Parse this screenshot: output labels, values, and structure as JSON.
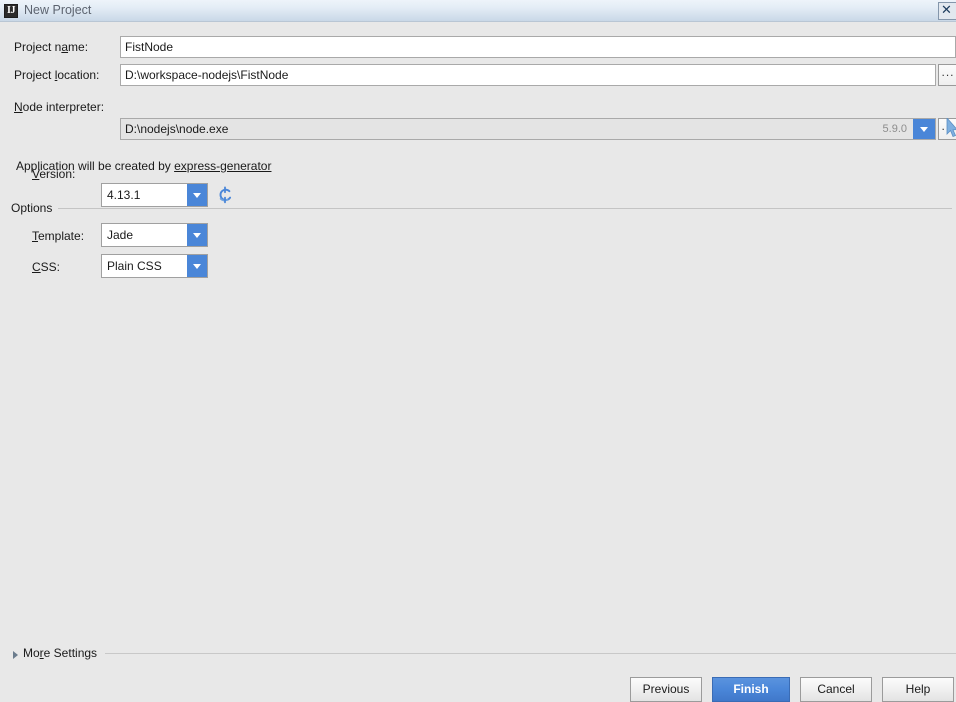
{
  "window": {
    "title": "New Project",
    "app_icon": "intellij-idea-icon",
    "app_icon_text": "IJ",
    "close_label": "✕"
  },
  "form": {
    "project_name": {
      "label_pre": "Project n",
      "label_mnemonic": "a",
      "label_post": "me:",
      "value": "FistNode",
      "placeholder": ""
    },
    "project_location": {
      "label_pre": "Project ",
      "label_mnemonic": "l",
      "label_post": "ocation:",
      "value": "D:\\workspace-nodejs\\FistNode",
      "placeholder": "",
      "browse_label": "..."
    },
    "node_interpreter": {
      "label_pre": "",
      "label_mnemonic": "N",
      "label_post": "ode interpreter:",
      "value": "D:\\nodejs\\node.exe",
      "version_badge": "5.9.0",
      "browse_label": "..."
    },
    "hint": {
      "text_before": "Application will be created by ",
      "link_text": "express-generator"
    },
    "version": {
      "label_pre": "",
      "label_mnemonic": "V",
      "label_post": "ersion:",
      "value": "4.13.1",
      "options": [
        "4.13.1"
      ],
      "refresh_icon": "refresh-icon"
    }
  },
  "options_section": {
    "title": "Options",
    "template": {
      "label_pre": "",
      "label_mnemonic": "T",
      "label_post": "emplate:",
      "value": "Jade",
      "options": [
        "Jade"
      ]
    },
    "css": {
      "label_pre": "",
      "label_mnemonic": "C",
      "label_post": "SS:",
      "value": "Plain CSS",
      "options": [
        "Plain CSS"
      ]
    }
  },
  "more_settings": {
    "label_pre": "Mo",
    "label_mnemonic": "r",
    "label_post": "e Settings",
    "expanded": false
  },
  "footer": {
    "previous_label": "Previous",
    "finish_label": "Finish",
    "cancel_label": "Cancel",
    "help_label": "Help"
  },
  "colors": {
    "accent_blue": "#4a86d8",
    "dialog_bg": "#e8e8e8",
    "titlebar_top": "#eef4fa",
    "titlebar_bottom": "#c9d8e7",
    "field_bg": "#ffffff",
    "disabled_field_bg": "#e4e4e4",
    "text": "#1a1a1a",
    "title_text": "#5d6470",
    "muted_text": "#8d8d8d"
  }
}
